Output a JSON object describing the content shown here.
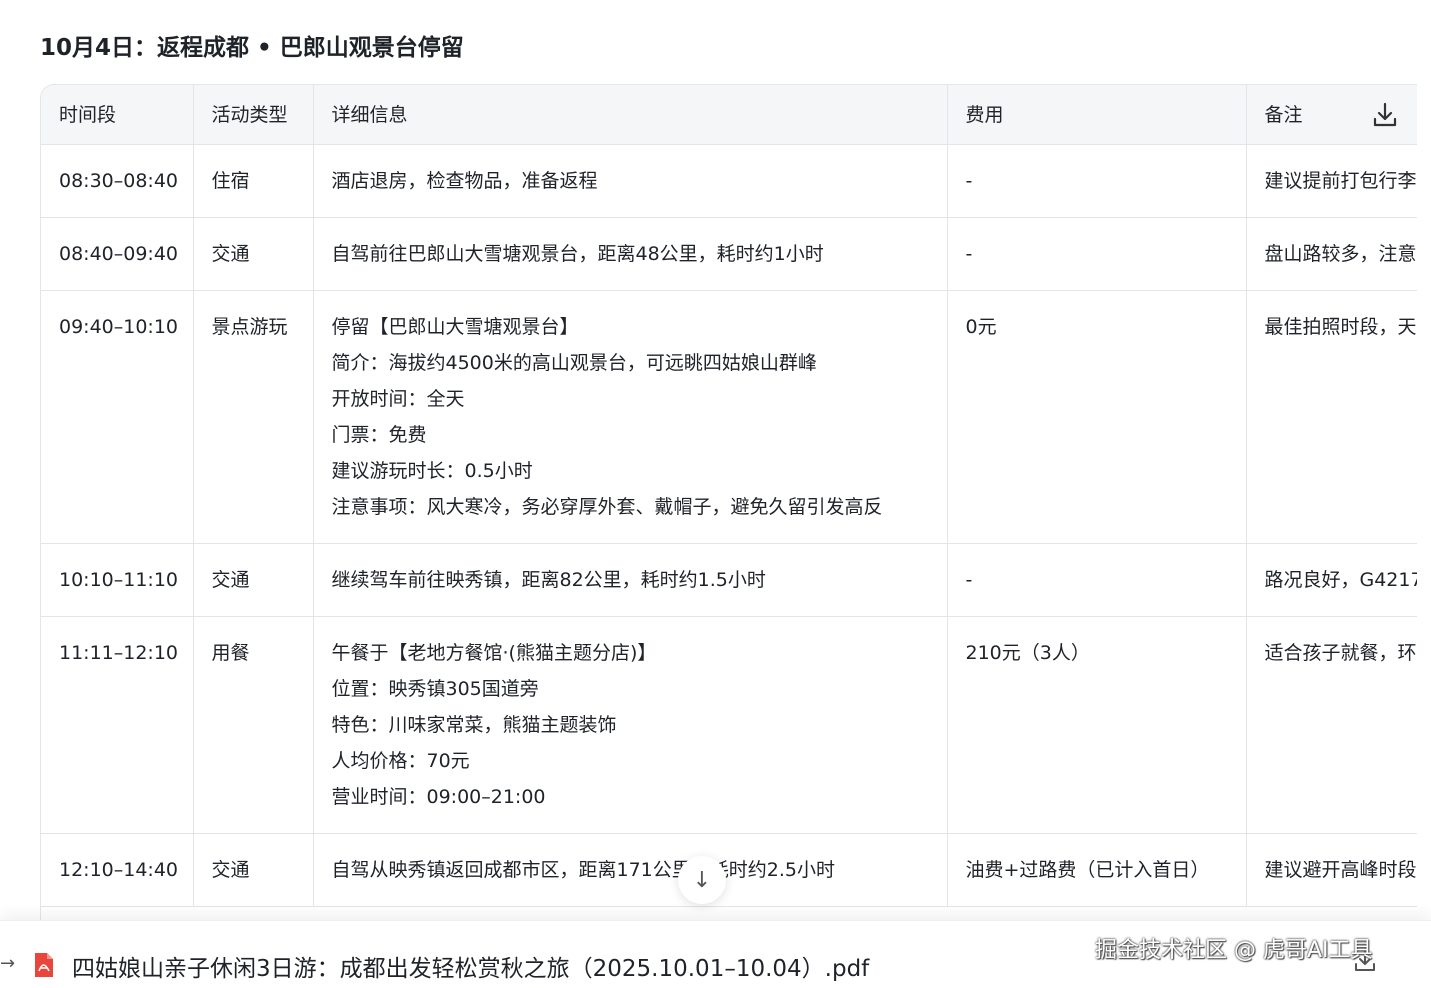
{
  "page_title": "10月4日：返程成都 • 巴郎山观景台停留",
  "table": {
    "headers": [
      "时间段",
      "活动类型",
      "详细信息",
      "费用",
      "备注"
    ],
    "rows": [
      {
        "time": "08:30–08:40",
        "type": "住宿",
        "details": [
          "酒店退房，检查物品，准备返程"
        ],
        "cost": "-",
        "note": "建议提前打包行李"
      },
      {
        "time": "08:40–09:40",
        "type": "交通",
        "details": [
          "自驾前往巴郎山大雪塘观景台，距离48公里，耗时约1小时"
        ],
        "cost": "-",
        "note": "盘山路较多，注意"
      },
      {
        "time": "09:40–10:10",
        "type": "景点游玩",
        "details": [
          "停留【巴郎山大雪塘观景台】",
          "简介：海拔约4500米的高山观景台，可远眺四姑娘山群峰",
          "开放时间：全天",
          "门票：免费",
          "建议游玩时长：0.5小时",
          "注意事项：风大寒冷，务必穿厚外套、戴帽子，避免久留引发高反"
        ],
        "cost": "0元",
        "note": "最佳拍照时段，天"
      },
      {
        "time": "10:10–11:10",
        "type": "交通",
        "details": [
          "继续驾车前往映秀镇，距离82公里，耗时约1.5小时"
        ],
        "cost": "-",
        "note": "路况良好，G4217"
      },
      {
        "time": "11:11–12:10",
        "type": "用餐",
        "details": [
          "午餐于【老地方餐馆·(熊猫主题分店)】",
          "位置：映秀镇305国道旁",
          "特色：川味家常菜，熊猫主题装饰",
          "人均价格：70元",
          "营业时间：09:00–21:00"
        ],
        "cost": "210元（3人）",
        "note": "适合孩子就餐，环"
      },
      {
        "time": "12:10–14:40",
        "type": "交通",
        "details": [
          "自驾从映秀镇返回成都市区，距离171公里，耗时约2.5小时"
        ],
        "cost": "油费+过路费（已计入首日）",
        "note": "建议避开高峰时段"
      }
    ]
  },
  "file": {
    "name": "四姑娘山亲子休闲3日游：成都出发轻松赏秋之旅（2025.10.01–10.04）.pdf",
    "icon": "pdf-file-icon"
  },
  "watermark": "掘金技术社区 @ 虎哥AI工具",
  "colors": {
    "header_bg": "#f5f6f7",
    "border": "#e3e5e8",
    "pdf_red": "#e8453c"
  }
}
